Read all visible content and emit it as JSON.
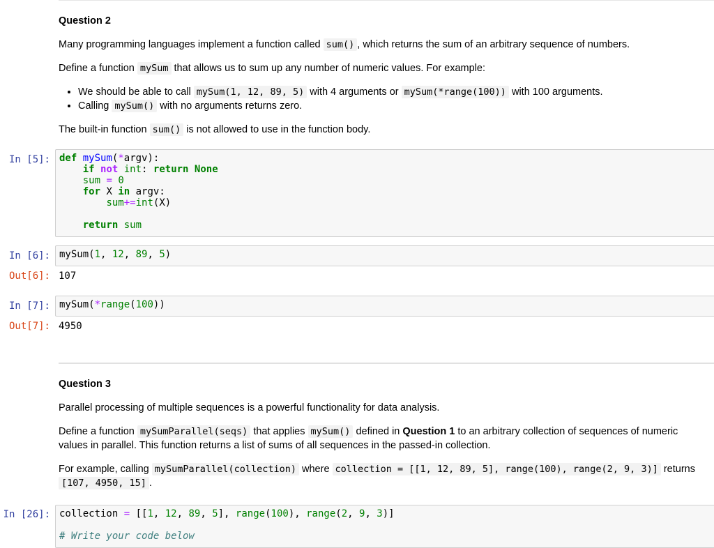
{
  "q2": {
    "heading": "Question 2",
    "p1_a": "Many programming languages implement a function called ",
    "p1_code": "sum()",
    "p1_b": ", which returns the sum of an arbitrary sequence of numbers.",
    "p2_a": "Define a function ",
    "p2_code": "mySum",
    "p2_b": " that allows us to sum up any number of numeric values. For example:",
    "b1_a": "We should be able to call ",
    "b1_code1": "mySum(1, 12, 89, 5)",
    "b1_b": " with 4 arguments or ",
    "b1_code2": "mySum(*range(100))",
    "b1_c": " with 100 arguments.",
    "b2_a": "Calling ",
    "b2_code": "mySum()",
    "b2_b": " with no arguments returns zero.",
    "p3_a": "The built-in function ",
    "p3_code": "sum()",
    "p3_b": " is not allowed to use in the function body."
  },
  "cells": {
    "c5_prompt": "In [5]:",
    "c6_prompt": "In [6]:",
    "c6_out_prompt": "Out[6]:",
    "c6_out": "107",
    "c7_prompt": "In [7]:",
    "c7_out_prompt": "Out[7]:",
    "c7_out": "4950",
    "c26_prompt": "In [26]:"
  },
  "code5": {
    "l1_kw": "def",
    "l1_fn": "mySum",
    "l1_rest_a": "(",
    "l1_op": "*",
    "l1_rest_b": "argv):",
    "l2_if": "if",
    "l2_not": "not",
    "l2_int": "int",
    "l2_colon": ": ",
    "l2_ret": "return",
    "l2_none": "None",
    "l3_var": "sum",
    "l3_eq": " = ",
    "l3_zero": "0",
    "l4_for": "for",
    "l4_x": " X ",
    "l4_in": "in",
    "l4_rest": " argv:",
    "l5_var": "sum",
    "l5_op": "+=",
    "l5_int": "int",
    "l5_rest": "(X)",
    "l7_ret": "return",
    "l7_var": " sum"
  },
  "code6": {
    "fn": "mySum(",
    "a1": "1",
    "a2": "12",
    "a3": "89",
    "a4": "5",
    "comma": ", ",
    "close": ")"
  },
  "code7": {
    "fn": "mySum(",
    "star": "*",
    "range": "range",
    "open": "(",
    "n": "100",
    "close": "))"
  },
  "q3": {
    "heading": "Question 3",
    "p1": "Parallel processing of multiple sequences is a powerful functionality for data analysis.",
    "p2_a": "Define a function ",
    "p2_code1": "mySumParallel(seqs)",
    "p2_b": " that applies ",
    "p2_code2": "mySum()",
    "p2_c": " defined in ",
    "p2_bold": "Question 1",
    "p2_d": " to an arbitrary collection of sequences of numeric values in parallel. This function returns a list of sums of all sequences in the passed-in collection.",
    "p3_a": "For example, calling ",
    "p3_code1": "mySumParallel(collection)",
    "p3_b": " where ",
    "p3_code2": "collection = [[1, 12, 89, 5], range(100), range(2, 9, 3)]",
    "p3_c": " returns ",
    "p3_code3": "[107, 4950, 15]",
    "p3_d": "."
  },
  "code26": {
    "var": "collection",
    "eq": " = ",
    "lb": "[[",
    "n1": "1",
    "n2": "12",
    "n3": "89",
    "n4": "5",
    "rb1": "], ",
    "range1": "range",
    "n5": "100",
    "mid": "), ",
    "range2": "range",
    "n6": "2",
    "n7": "9",
    "n8": "3",
    "end": ")]",
    "comma": ", ",
    "paren": "(",
    "comment": "# Write your code below"
  }
}
